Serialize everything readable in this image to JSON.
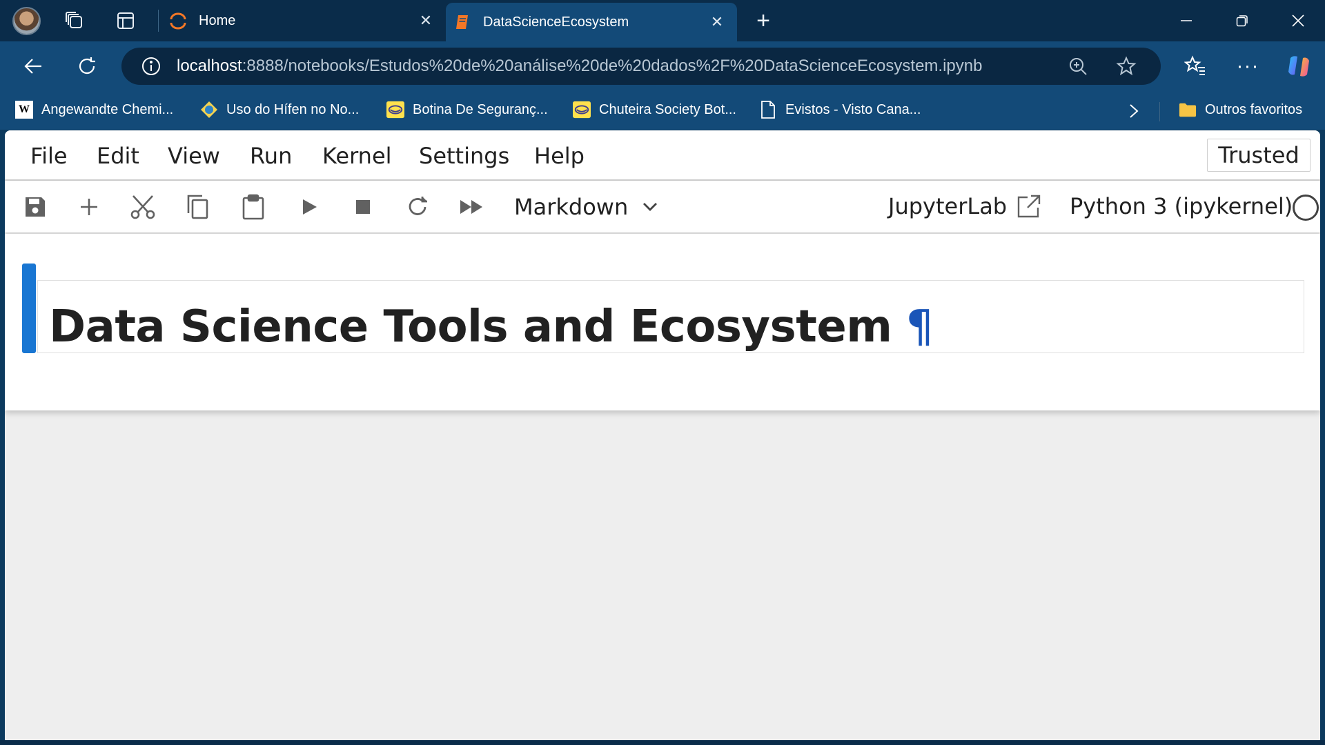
{
  "browser": {
    "tabs": [
      {
        "label": "Home"
      },
      {
        "label": "DataScienceEcosystem"
      }
    ],
    "url": {
      "host": "localhost",
      "rest": ":8888/notebooks/Estudos%20de%20análise%20de%20dados%2F%20DataScienceEcosystem.ipynb"
    },
    "bookmarks": [
      {
        "label": "Angewandte Chemi...",
        "icon_text": "W"
      },
      {
        "label": "Uso do Hífen no No..."
      },
      {
        "label": "Botina De Seguranç..."
      },
      {
        "label": "Chuteira Society Bot..."
      },
      {
        "label": "Evistos - Visto Cana..."
      }
    ],
    "other_favorites": "Outros favoritos"
  },
  "jupyter": {
    "menu": [
      "File",
      "Edit",
      "View",
      "Run",
      "Kernel",
      "Settings",
      "Help"
    ],
    "trusted": "Trusted",
    "cell_type": "Markdown",
    "jupyterlab_link": "JupyterLab",
    "kernel": "Python 3 (ipykernel)",
    "cell": {
      "heading": "Data Science Tools and Ecosystem",
      "anchor": "¶"
    }
  },
  "colors": {
    "tabbar": "#0a2c4a",
    "chrome": "#134a78",
    "cell_selected_bar": "#1976d2",
    "anchor": "#1a55b8",
    "page_bg": "#eeeeee"
  }
}
